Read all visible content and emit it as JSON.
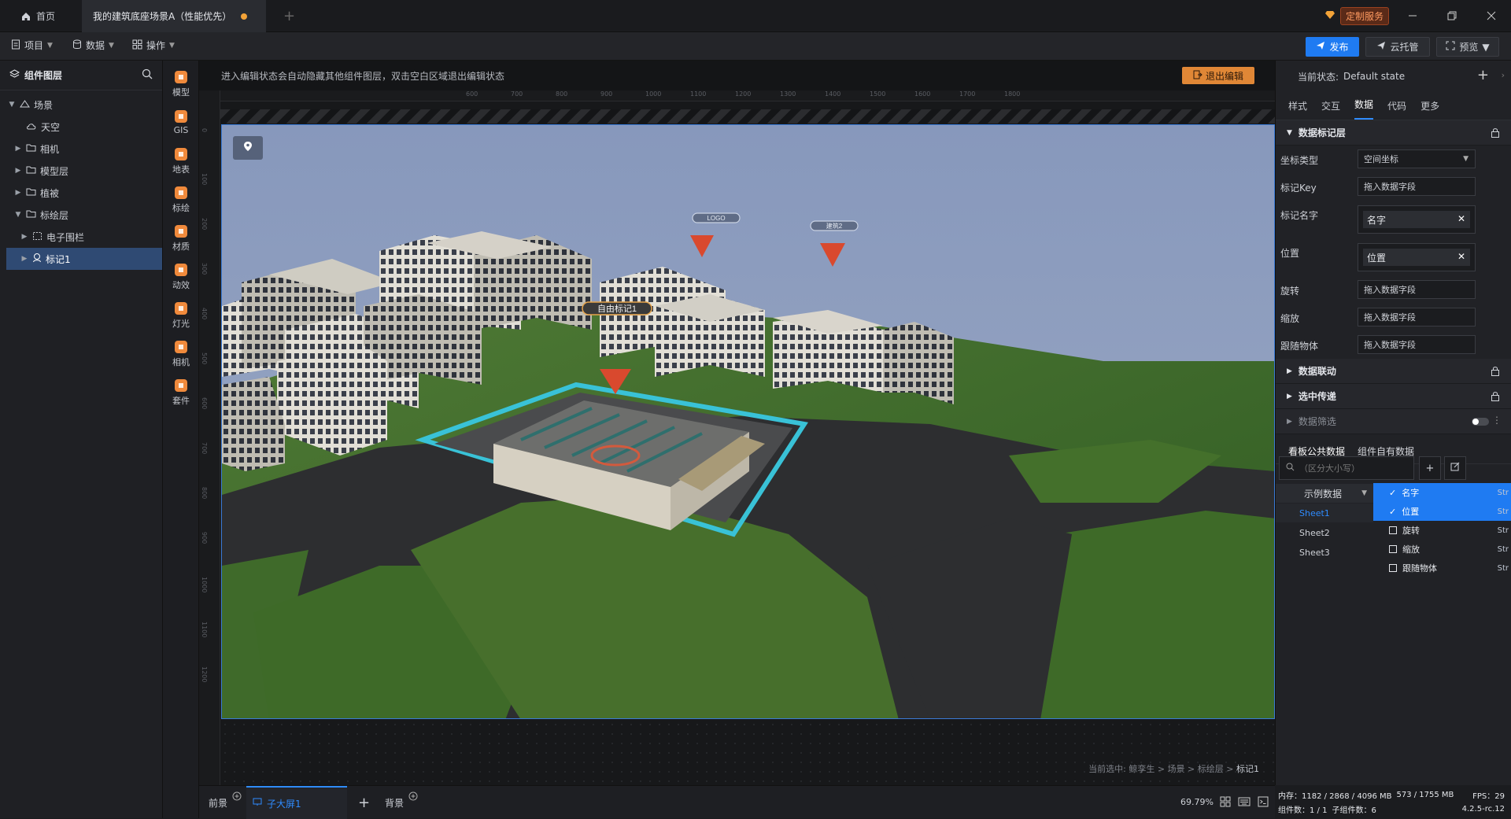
{
  "titlebar": {
    "home": "首页",
    "doc_title": "我的建筑底座场景A（性能优先）",
    "custom_service": "定制服务"
  },
  "menubar": {
    "project": "项目",
    "data": "数据",
    "operate": "操作",
    "publish": "发布",
    "cloud": "云托管",
    "preview": "预览"
  },
  "layers": {
    "title": "组件图层",
    "items": [
      {
        "label": "场景",
        "depth": 0,
        "expanded": true,
        "icon": "scene-icon"
      },
      {
        "label": "天空",
        "depth": 1,
        "expanded": null,
        "icon": "sky-icon"
      },
      {
        "label": "相机",
        "depth": 1,
        "expanded": false,
        "icon": "folder-icon"
      },
      {
        "label": "模型层",
        "depth": 1,
        "expanded": false,
        "icon": "folder-icon"
      },
      {
        "label": "植被",
        "depth": 1,
        "expanded": false,
        "icon": "folder-icon"
      },
      {
        "label": "标绘层",
        "depth": 1,
        "expanded": true,
        "icon": "folder-icon"
      },
      {
        "label": "电子围栏",
        "depth": 2,
        "expanded": false,
        "icon": "fence-icon"
      },
      {
        "label": "标记1",
        "depth": 2,
        "expanded": false,
        "icon": "marker-icon",
        "selected": true
      }
    ]
  },
  "toolbox": [
    {
      "label": "模型",
      "icon": "model-icon"
    },
    {
      "label": "GIS",
      "icon": "gis-icon"
    },
    {
      "label": "地表",
      "icon": "terrain-icon"
    },
    {
      "label": "标绘",
      "icon": "plot-icon"
    },
    {
      "label": "材质",
      "icon": "material-icon"
    },
    {
      "label": "动效",
      "icon": "effect-icon"
    },
    {
      "label": "灯光",
      "icon": "light-icon"
    },
    {
      "label": "相机",
      "icon": "camera-icon"
    },
    {
      "label": "套件",
      "icon": "kit-icon"
    }
  ],
  "canvas": {
    "notice": "进入编辑状态会自动隐藏其他组件图层，双击空白区域退出编辑状态",
    "exit_edit": "退出编辑",
    "ruler_top": [
      "600",
      "700",
      "800",
      "900",
      "1000",
      "1100",
      "1200",
      "1300",
      "1400",
      "1500",
      "1600",
      "1700",
      "1800"
    ],
    "ruler_left": [
      "0",
      "100",
      "200",
      "300",
      "400",
      "500",
      "600",
      "700",
      "800",
      "900",
      "1000",
      "1100",
      "1200"
    ],
    "markers": [
      "自由标记1",
      "LOGO",
      "建筑2"
    ],
    "breadcrumb_prefix": "当前选中:",
    "breadcrumb": [
      "鲸孪生",
      "场景",
      "标绘层"
    ],
    "breadcrumb_last": "标记1"
  },
  "bottombar": {
    "front": "前景",
    "sub_screen": "子大屏1",
    "back": "背景",
    "zoom": "69.79%"
  },
  "rightpanel": {
    "state_label": "当前状态:",
    "state_value": "Default state",
    "tabs": [
      "样式",
      "交互",
      "数据",
      "代码",
      "更多"
    ],
    "active_tab": "数据",
    "section_marker": "数据标记层",
    "fields": {
      "coord_type_label": "坐标类型",
      "coord_type_value": "空间坐标",
      "key_label": "标记Key",
      "key_value": "拖入数据字段",
      "name_label": "标记名字",
      "name_chip": "名字",
      "pos_label": "位置",
      "pos_chip": "位置",
      "rot_label": "旋转",
      "rot_value": "拖入数据字段",
      "scale_label": "缩放",
      "scale_value": "拖入数据字段",
      "follow_label": "跟随物体",
      "follow_value": "拖入数据字段"
    },
    "section_link": "数据联动",
    "section_select": "选中传递",
    "section_filter": "数据筛选",
    "ds_tabs": [
      "看板公共数据",
      "组件自有数据"
    ],
    "search_placeholder": "（区分大小写）",
    "dataset": "示例数据",
    "sheets": [
      "Sheet1",
      "Sheet2",
      "Sheet3"
    ],
    "columns": [
      {
        "name": "名字",
        "type": "Str",
        "checked": true
      },
      {
        "name": "位置",
        "type": "Str",
        "checked": true
      },
      {
        "name": "旋转",
        "type": "Str",
        "checked": false
      },
      {
        "name": "缩放",
        "type": "Str",
        "checked": false
      },
      {
        "name": "跟随物体",
        "type": "Str",
        "checked": false
      }
    ]
  },
  "status": {
    "mem": "内存：1182 / 2868 / 4096 MB",
    "gpu": "573 / 1755 MB",
    "fps": "FPS：29",
    "components": "组件数：1 / 1",
    "children": "子组件数：6",
    "version": "4.2.5-rc.12"
  },
  "colors": {
    "accent": "#1f7bf2",
    "warning": "#e08736",
    "selection": "#2f4a73"
  }
}
